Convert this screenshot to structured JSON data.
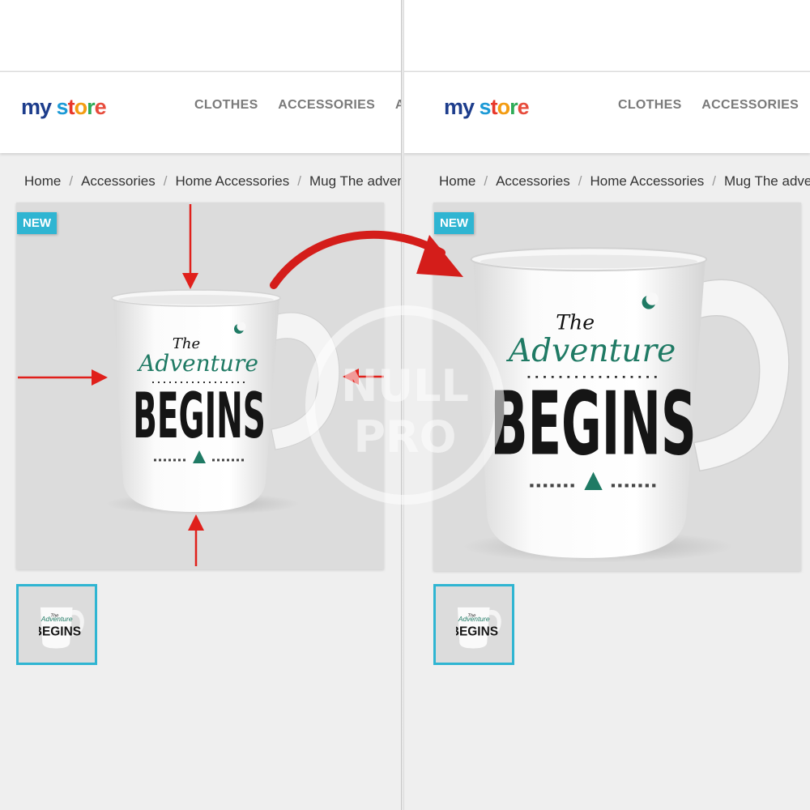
{
  "logo": {
    "my": "my",
    "store_letters": [
      "s",
      "t",
      "o",
      "r",
      "e"
    ]
  },
  "nav": {
    "items": [
      "CLOTHES",
      "ACCESSORIES",
      "ART"
    ]
  },
  "breadcrumb": {
    "items": [
      "Home",
      "Accessories",
      "Home Accessories",
      "Mug The advent"
    ],
    "separator": "/"
  },
  "product": {
    "badge": "NEW",
    "mug_text": {
      "the": "The",
      "adventure": "Adventure",
      "begins": "BEGINS"
    }
  },
  "watermark": {
    "line1": "NULL",
    "line2": "PRO"
  },
  "colors": {
    "accent": "#2fb5d2",
    "arrow": "#e0201b",
    "mug_green": "#1f7a64"
  }
}
